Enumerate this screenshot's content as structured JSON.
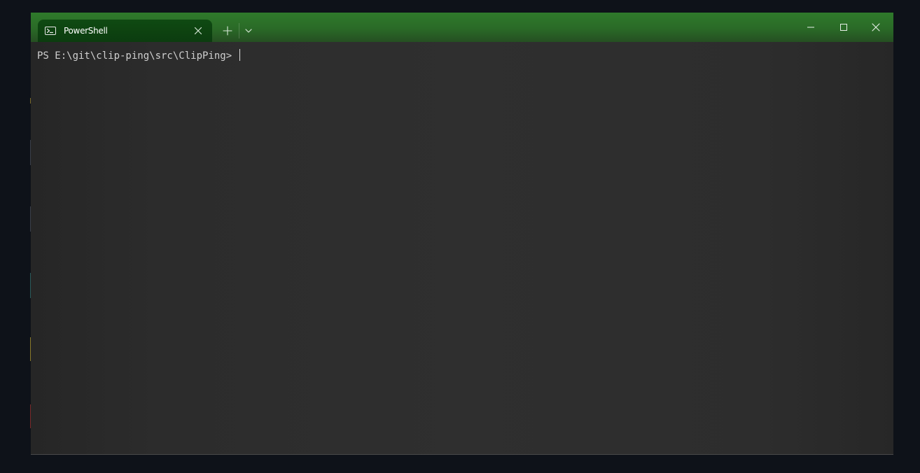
{
  "window": {
    "tab": {
      "title": "PowerShell",
      "icon": "powershell-icon",
      "close_icon": "close-icon"
    },
    "new_tab_icon": "plus-icon",
    "dropdown_icon": "chevron-down-icon",
    "controls": {
      "minimize_icon": "minimize-icon",
      "maximize_icon": "maximize-icon",
      "close_icon": "close-icon"
    },
    "colors": {
      "titlebar": "#2a6a27",
      "active_tab": "#0d3f10",
      "terminal_bg": "#2c2c2c",
      "terminal_text": "#d0d0d0"
    }
  },
  "terminal": {
    "prompt": "PS E:\\git\\clip-ping\\src\\ClipPing> "
  }
}
